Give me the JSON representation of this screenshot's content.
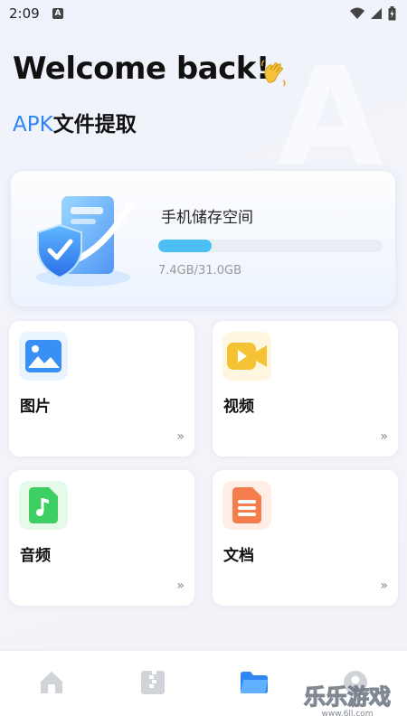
{
  "status_bar": {
    "time": "2:09",
    "notification_badge": "A"
  },
  "header": {
    "welcome": "Welcome back!",
    "subtitle_accent": "APK",
    "subtitle_rest": "文件提取",
    "decor_letter": "A"
  },
  "storage": {
    "title": "手机储存空间",
    "amount": "7.4GB/31.0GB",
    "used_fraction": 0.239,
    "accent_color": "#4cc0f4"
  },
  "categories": [
    {
      "label": "图片",
      "icon": "image-icon",
      "chevron": "»"
    },
    {
      "label": "视频",
      "icon": "video-icon",
      "chevron": "»"
    },
    {
      "label": "音频",
      "icon": "audio-icon",
      "chevron": "»"
    },
    {
      "label": "文档",
      "icon": "document-icon",
      "chevron": "»"
    }
  ],
  "bottom_nav": [
    {
      "icon": "home-icon",
      "active": false
    },
    {
      "icon": "archive-icon",
      "active": false
    },
    {
      "icon": "folder-icon",
      "active": true
    },
    {
      "icon": "profile-icon",
      "active": false
    }
  ],
  "watermark": {
    "text": "乐乐游戏",
    "url_text": "www.6ll.com"
  }
}
